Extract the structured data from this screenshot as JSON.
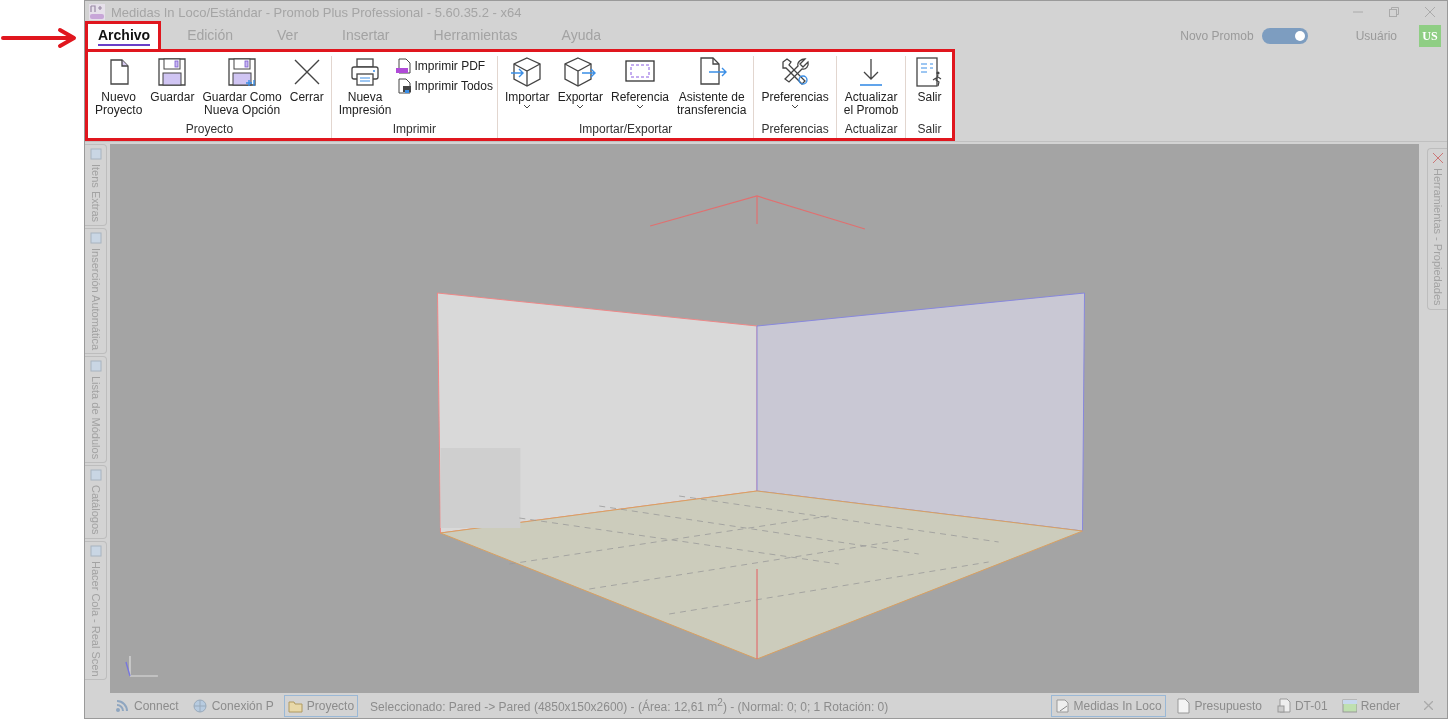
{
  "window": {
    "title": "Medidas In Loco/Estándar - Promob Plus Professional - 5.60.35.2 - x64"
  },
  "tabs": [
    {
      "label": "Archivo",
      "selected": true
    },
    {
      "label": "Edición",
      "selected": false
    },
    {
      "label": "Ver",
      "selected": false
    },
    {
      "label": "Insertar",
      "selected": false
    },
    {
      "label": "Herramientas",
      "selected": false
    },
    {
      "label": "Ayuda",
      "selected": false
    }
  ],
  "header_right": {
    "toggle_label": "Novo Promob",
    "toggle_on": true,
    "user_label": "Usuário",
    "avatar": "US"
  },
  "ribbon": {
    "groups": [
      {
        "label": "Proyecto",
        "items": [
          {
            "kind": "large",
            "label": "Nuevo\nProyecto",
            "dropdown": false
          },
          {
            "kind": "large",
            "label": "Guardar",
            "dropdown": false
          },
          {
            "kind": "large",
            "label": "Guardar Como\nNueva Opción",
            "dropdown": false
          },
          {
            "kind": "large",
            "label": "Cerrar",
            "dropdown": false
          }
        ]
      },
      {
        "label": "Imprimir",
        "items": [
          {
            "kind": "large",
            "label": "Nueva\nImpresión",
            "dropdown": false
          },
          {
            "kind": "small",
            "label": "Imprimir PDF",
            "dropdown": false
          },
          {
            "kind": "small",
            "label": "Imprimir Todos",
            "dropdown": false
          }
        ]
      },
      {
        "label": "Importar/Exportar",
        "items": [
          {
            "kind": "large",
            "label": "Importar",
            "dropdown": true
          },
          {
            "kind": "large",
            "label": "Exportar",
            "dropdown": true
          },
          {
            "kind": "large",
            "label": "Referencia",
            "dropdown": true
          },
          {
            "kind": "large",
            "label": "Asistente de\ntransferencia",
            "dropdown": false
          }
        ]
      },
      {
        "label": "Preferencias",
        "items": [
          {
            "kind": "large",
            "label": "Preferencias",
            "dropdown": true
          }
        ]
      },
      {
        "label": "Actualizar",
        "items": [
          {
            "kind": "large",
            "label": "Actualizar\nel Promob",
            "dropdown": false
          }
        ]
      },
      {
        "label": "Salir",
        "items": [
          {
            "kind": "large",
            "label": "Salir",
            "dropdown": false
          }
        ]
      }
    ]
  },
  "left_panels": [
    "Itens Extras",
    "Inserción Automática",
    "Lista de Módulos",
    "Catálogos",
    "Hacer Cola - Real Scen"
  ],
  "right_panels": [
    "Herramientas - Propiedades"
  ],
  "status_bar": {
    "left_items": [
      {
        "label": "Connect",
        "selected": false
      },
      {
        "label": "Conexión P",
        "selected": false
      },
      {
        "label": "Proyecto",
        "selected": true
      }
    ],
    "message": "Seleccionado: Pared -> Pared (4850x150x2600) - (Área: 12,61 m$^{2}$) - (Normal: 0; 0; 1 Rotación: 0)",
    "right_items": [
      {
        "label": "Medidas In Loco",
        "selected": true
      },
      {
        "label": "Presupuesto",
        "selected": false
      },
      {
        "label": "DT-01",
        "selected": false
      },
      {
        "label": "Render",
        "selected": false
      }
    ]
  }
}
